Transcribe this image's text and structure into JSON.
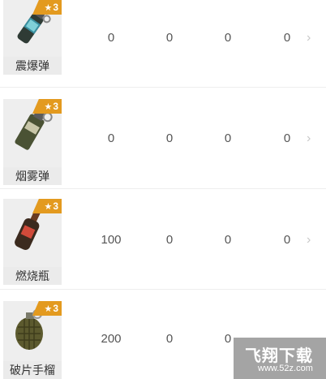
{
  "items": [
    {
      "name": "震爆弹",
      "stars": "3",
      "icon": "stun-grenade-icon",
      "values": [
        "0",
        "0",
        "0",
        "0"
      ]
    },
    {
      "name": "烟雾弹",
      "stars": "3",
      "icon": "smoke-grenade-icon",
      "values": [
        "0",
        "0",
        "0",
        "0"
      ]
    },
    {
      "name": "燃烧瓶",
      "stars": "3",
      "icon": "molotov-icon",
      "values": [
        "100",
        "0",
        "0",
        "0"
      ]
    },
    {
      "name": "破片手榴",
      "stars": "3",
      "icon": "frag-grenade-icon",
      "values": [
        "200",
        "0",
        "0",
        ""
      ]
    }
  ],
  "watermark": {
    "title": "飞翔下载",
    "url": "www.52z.com"
  },
  "colors": {
    "badge": "#e39a1f",
    "thumb_bg": "#eeeeee",
    "chevron": "#c8c8c8"
  }
}
